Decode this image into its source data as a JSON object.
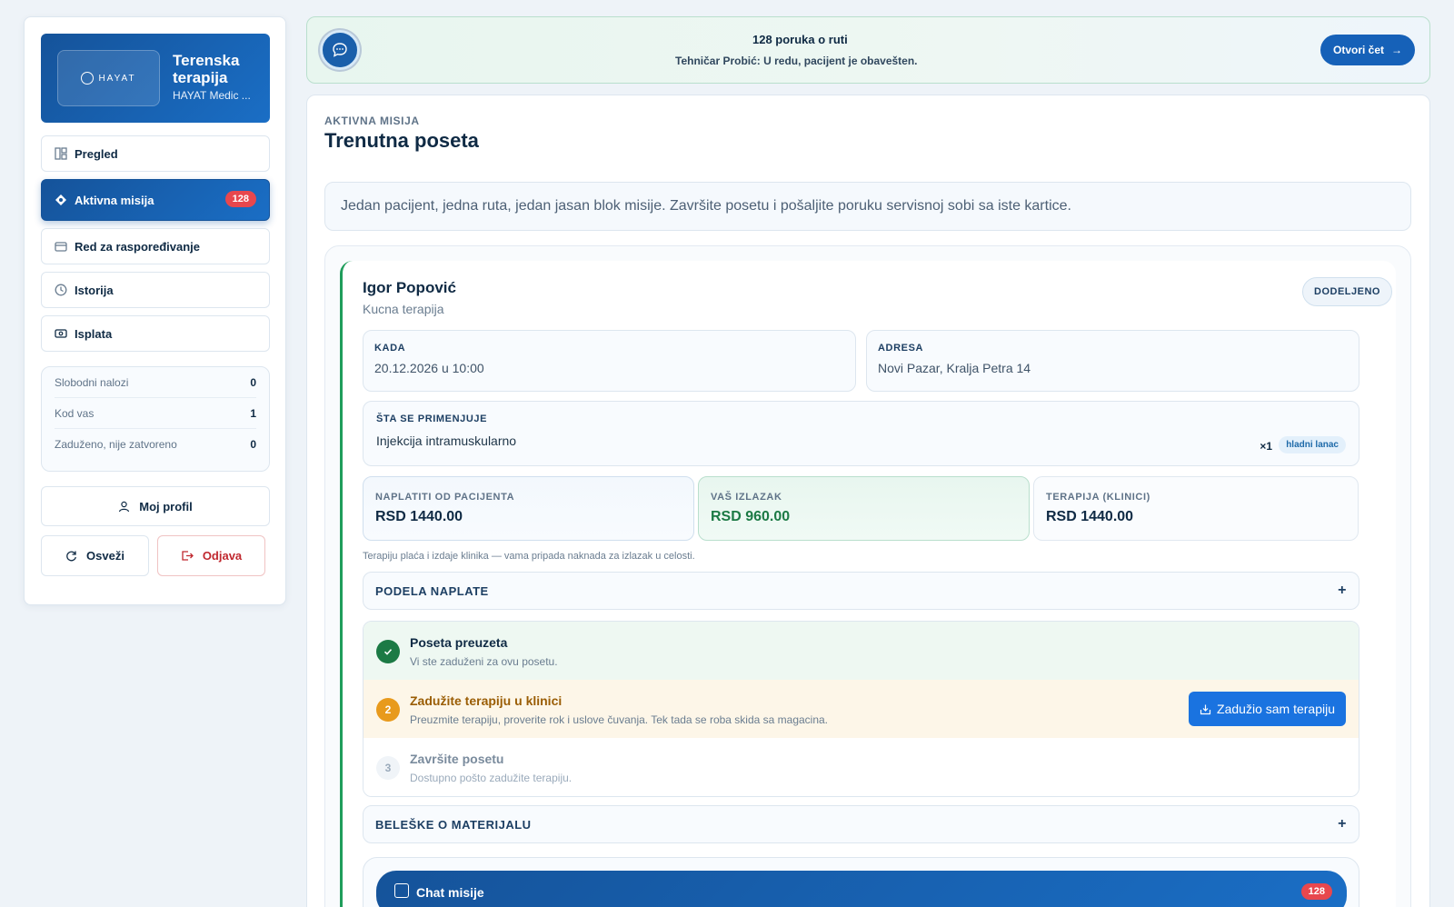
{
  "brand": {
    "logo_text": "HAYAT",
    "title": "Terenska terapija",
    "subtitle": "HAYAT Medic ..."
  },
  "nav": {
    "items": [
      {
        "label": "Pregled",
        "icon": "dashboard-icon"
      },
      {
        "label": "Aktivna misija",
        "icon": "mission-icon",
        "badge": "128"
      },
      {
        "label": "Red za raspoređivanje",
        "icon": "queue-icon"
      },
      {
        "label": "Istorija",
        "icon": "clock-icon"
      },
      {
        "label": "Isplata",
        "icon": "payout-icon"
      }
    ]
  },
  "stats": [
    {
      "label": "Slobodni nalozi",
      "value": "0"
    },
    {
      "label": "Kod vas",
      "value": "1"
    },
    {
      "label": "Zaduženo, nije zatvoreno",
      "value": "0"
    }
  ],
  "actions": {
    "profile": "Moj profil",
    "refresh": "Osveži",
    "logout": "Odjava"
  },
  "chat_banner": {
    "title": "128 poruka o ruti",
    "last_message": "Tehničar Probić: U redu, pacijent je obavešten.",
    "open_label": "Otvori čet"
  },
  "main": {
    "eyebrow": "AKTIVNA MISIJA",
    "title": "Trenutna poseta",
    "intro": "Jedan pacijent, jedna ruta, jedan jasan blok misije. Završite posetu i pošaljite poruku servisnoj sobi sa iste kartice."
  },
  "visit": {
    "patient_name": "Igor Popović",
    "patient_type": "Kucna terapija",
    "status": "DODELJENO",
    "when_label": "KADA",
    "when_value": "20.12.2026 u 10:00",
    "address_label": "ADRESA",
    "address_value": "Novi Pazar, Kralja Petra 14",
    "apply_label": "ŠTA SE PRIMENJUJE",
    "apply_item": "Injekcija intramuskularno",
    "apply_qty": "×1",
    "apply_tag": "hladni lanac",
    "money": [
      {
        "label": "NAPLATITI OD PACIJENTA",
        "value": "RSD 1440.00"
      },
      {
        "label": "VAŠ IZLAZAK",
        "value": "RSD 960.00"
      },
      {
        "label": "TERAPIJA (KLINICI)",
        "value": "RSD 1440.00"
      }
    ],
    "note": "Terapiju plaća i izdaje klinika — vama pripada naknada za izlazak u celosti.",
    "split_label": "PODELA NAPLATE",
    "steps": [
      {
        "num": "✓",
        "title": "Poseta preuzeta",
        "desc": "Vi ste zaduženi za ovu posetu."
      },
      {
        "num": "2",
        "title": "Zadužite terapiju u klinici",
        "desc": "Preuzmite terapiju, proverite rok i uslove čuvanja. Tek tada se roba skida sa magacina.",
        "button": "Zadužio sam terapiju"
      },
      {
        "num": "3",
        "title": "Završite posetu",
        "desc": "Dostupno pošto zadužite terapiju."
      }
    ],
    "notes_label": "BELEŠKE O MATERIJALU",
    "chat_title": "Chat misije",
    "chat_badge": "128"
  },
  "colors": {
    "primary": "#15539a",
    "accent_button": "#1a73e0",
    "success": "#1c7a45",
    "warning": "#e89a1c",
    "danger": "#c0282f"
  }
}
